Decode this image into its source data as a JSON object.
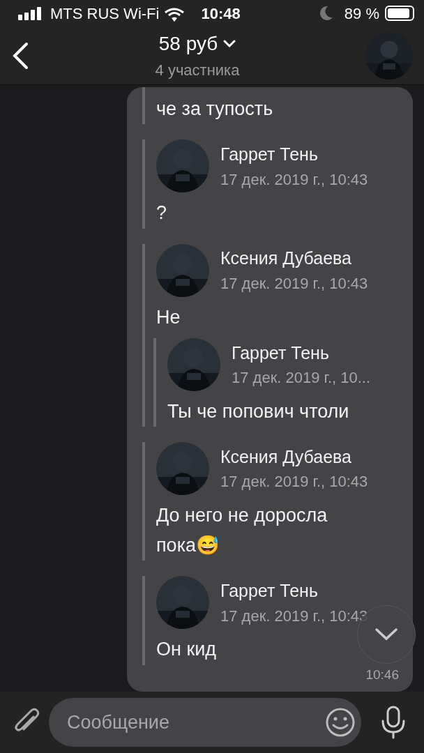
{
  "status_bar": {
    "carrier": "MTS RUS Wi-Fi",
    "time": "10:48",
    "battery": "89 %"
  },
  "header": {
    "title": "58 руб",
    "subtitle": "4 участника"
  },
  "message": {
    "forwarded": [
      {
        "text": "че за тупость"
      },
      {
        "author": "Гаррет Тень",
        "date": "17 дек. 2019 г., 10:43",
        "text": "?"
      },
      {
        "author": "Ксения Дубаева",
        "date": "17 дек. 2019 г., 10:43",
        "text": "Не",
        "forwarded": [
          {
            "author": "Гаррет Тень",
            "date": "17 дек. 2019 г., 10...",
            "text": "Ты че попович чтоли"
          }
        ]
      },
      {
        "author": "Ксения Дубаева",
        "date": "17 дек. 2019 г., 10:43",
        "text": "До него не доросла пока😅"
      },
      {
        "author": "Гаррет Тень",
        "date": "17 дек. 2019 г., 10:43",
        "text": "Он кид"
      }
    ],
    "time": "10:46"
  },
  "composer": {
    "placeholder": "Сообщение"
  }
}
